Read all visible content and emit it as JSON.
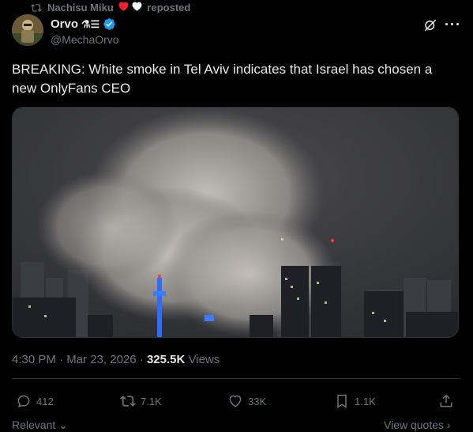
{
  "repost": {
    "user": "Nachisu Miku",
    "label": "reposted"
  },
  "author": {
    "name": "Orvo",
    "handle": "@MechaOrvo",
    "name_suffix": "⚗☰"
  },
  "tweet": {
    "text": "BREAKING: White smoke in Tel Aviv indicates that Israel has chosen a new OnlyFans CEO",
    "time": "4:30 PM",
    "date": "Mar 23, 2026",
    "views_count": "325.5K",
    "views_label": "Views"
  },
  "actions": {
    "replies": "412",
    "reposts": "7.1K",
    "likes": "33K",
    "bookmarks": "1.1K"
  },
  "footer": {
    "relevant": "Relevant",
    "view_quotes": "View quotes"
  },
  "colors": {
    "background": "#000000",
    "muted": "#71767b",
    "verified": "#1d9bf0",
    "heart": "#f4212e"
  }
}
